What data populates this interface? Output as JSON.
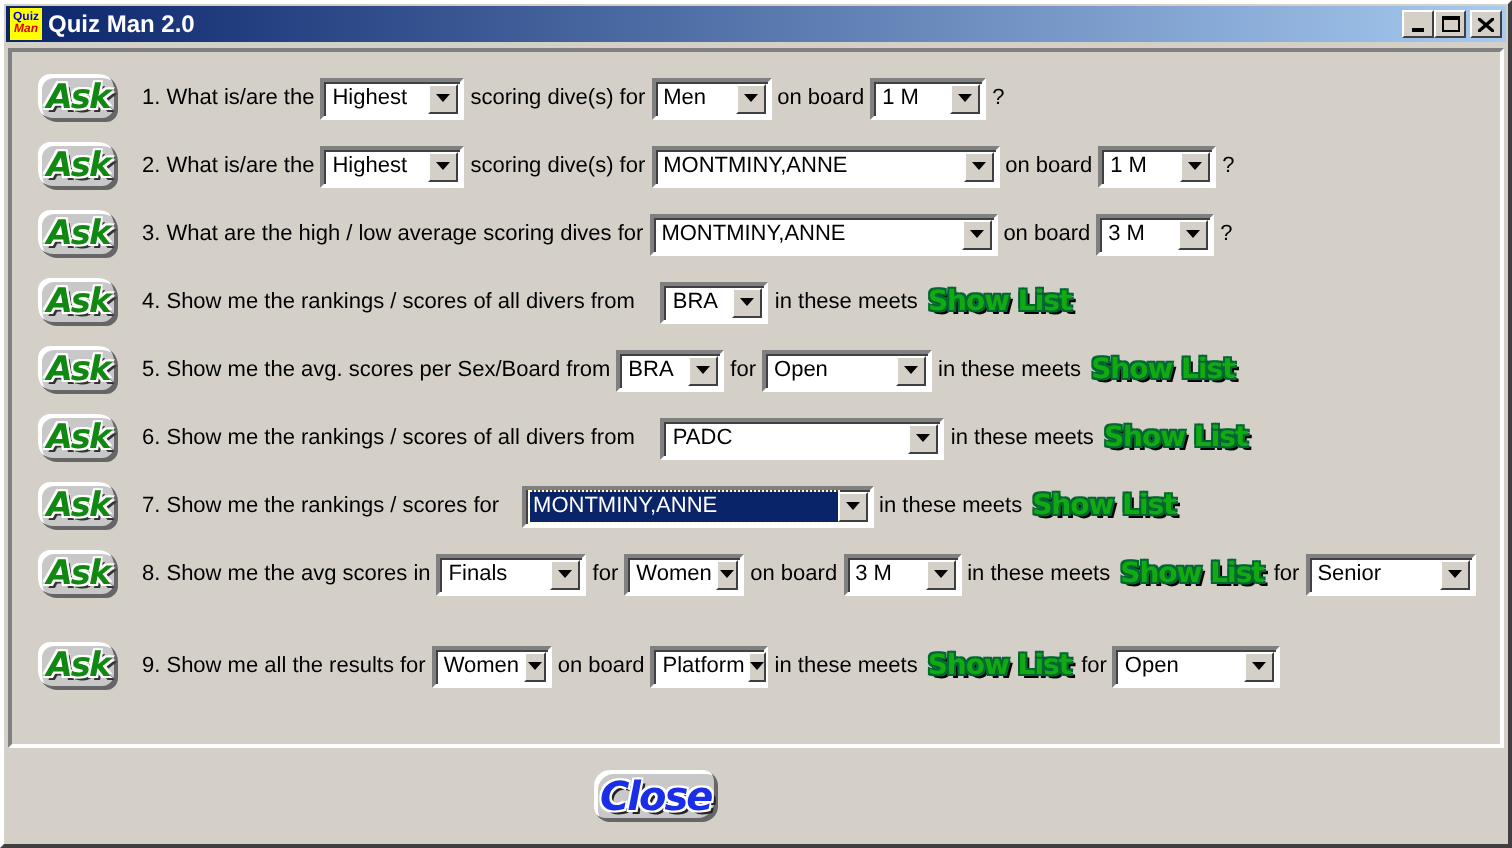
{
  "window": {
    "title": "Quiz Man 2.0",
    "icon_text": [
      "Quiz",
      "Man"
    ]
  },
  "questions": [
    {
      "ask": "Ask",
      "parts": [
        {
          "kind": "text",
          "text": "1. What is/are the"
        },
        {
          "kind": "select",
          "value": "Highest",
          "selected": false
        },
        {
          "kind": "text",
          "text": "scoring dive(s) for"
        },
        {
          "kind": "select",
          "value": "Men",
          "selected": false
        },
        {
          "kind": "text",
          "text": "on board"
        },
        {
          "kind": "select",
          "value": "1 M",
          "selected": false
        },
        {
          "kind": "text",
          "text": "?"
        }
      ]
    },
    {
      "ask": "Ask",
      "parts": [
        {
          "kind": "text",
          "text": "2. What is/are the"
        },
        {
          "kind": "select",
          "value": "Highest",
          "selected": false
        },
        {
          "kind": "text",
          "text": "scoring dive(s) for"
        },
        {
          "kind": "select",
          "value": "MONTMINY,ANNE",
          "selected": false
        },
        {
          "kind": "text",
          "text": "on board"
        },
        {
          "kind": "select",
          "value": "1 M",
          "selected": false
        },
        {
          "kind": "text",
          "text": "?"
        }
      ]
    },
    {
      "ask": "Ask",
      "parts": [
        {
          "kind": "text",
          "text": "3. What are the high / low average scoring dives for"
        },
        {
          "kind": "select",
          "value": "MONTMINY,ANNE",
          "selected": false
        },
        {
          "kind": "text",
          "text": "on board"
        },
        {
          "kind": "select",
          "value": "3 M",
          "selected": false
        },
        {
          "kind": "text",
          "text": "?"
        }
      ]
    },
    {
      "ask": "Ask",
      "parts": [
        {
          "kind": "text",
          "text": "4. Show me the rankings / scores of all divers from"
        },
        {
          "kind": "select",
          "value": "BRA",
          "selected": false
        },
        {
          "kind": "text",
          "text": "in these meets"
        },
        {
          "kind": "showlist",
          "text": "Show List"
        }
      ]
    },
    {
      "ask": "Ask",
      "parts": [
        {
          "kind": "text",
          "text": "5. Show me the avg. scores per Sex/Board from"
        },
        {
          "kind": "select",
          "value": "BRA",
          "selected": false
        },
        {
          "kind": "text",
          "text": "for"
        },
        {
          "kind": "select",
          "value": "Open",
          "selected": false
        },
        {
          "kind": "text",
          "text": "in these meets"
        },
        {
          "kind": "showlist",
          "text": "Show List"
        }
      ]
    },
    {
      "ask": "Ask",
      "parts": [
        {
          "kind": "text",
          "text": "6. Show me the rankings / scores of all divers from"
        },
        {
          "kind": "select",
          "value": "PADC",
          "selected": false
        },
        {
          "kind": "text",
          "text": "in these meets"
        },
        {
          "kind": "showlist",
          "text": "Show List"
        }
      ]
    },
    {
      "ask": "Ask",
      "parts": [
        {
          "kind": "text",
          "text": "7. Show me the rankings / scores for"
        },
        {
          "kind": "select",
          "value": "MONTMINY,ANNE",
          "selected": true
        },
        {
          "kind": "text",
          "text": "in these meets"
        },
        {
          "kind": "showlist",
          "text": "Show List"
        }
      ]
    },
    {
      "ask": "Ask",
      "parts": [
        {
          "kind": "text",
          "text": "8. Show me the avg scores in"
        },
        {
          "kind": "select",
          "value": "Finals",
          "selected": false
        },
        {
          "kind": "text",
          "text": "for"
        },
        {
          "kind": "select",
          "value": "Women",
          "selected": false
        },
        {
          "kind": "text",
          "text": "on board"
        },
        {
          "kind": "select",
          "value": "3 M",
          "selected": false
        },
        {
          "kind": "text",
          "text": "in these meets"
        },
        {
          "kind": "showlist",
          "text": "Show List"
        },
        {
          "kind": "text",
          "text": "for"
        },
        {
          "kind": "select",
          "value": "Senior",
          "selected": false
        }
      ]
    },
    {
      "ask": "Ask",
      "parts": [
        {
          "kind": "text",
          "text": "9. Show me all the results for"
        },
        {
          "kind": "select",
          "value": "Women",
          "selected": false
        },
        {
          "kind": "text",
          "text": "on board"
        },
        {
          "kind": "select",
          "value": "Platform",
          "selected": false
        },
        {
          "kind": "text",
          "text": "in these meets"
        },
        {
          "kind": "showlist",
          "text": "Show List"
        },
        {
          "kind": "text",
          "text": "for"
        },
        {
          "kind": "select",
          "value": "Open",
          "selected": false
        }
      ]
    }
  ],
  "close_button": "Close"
}
